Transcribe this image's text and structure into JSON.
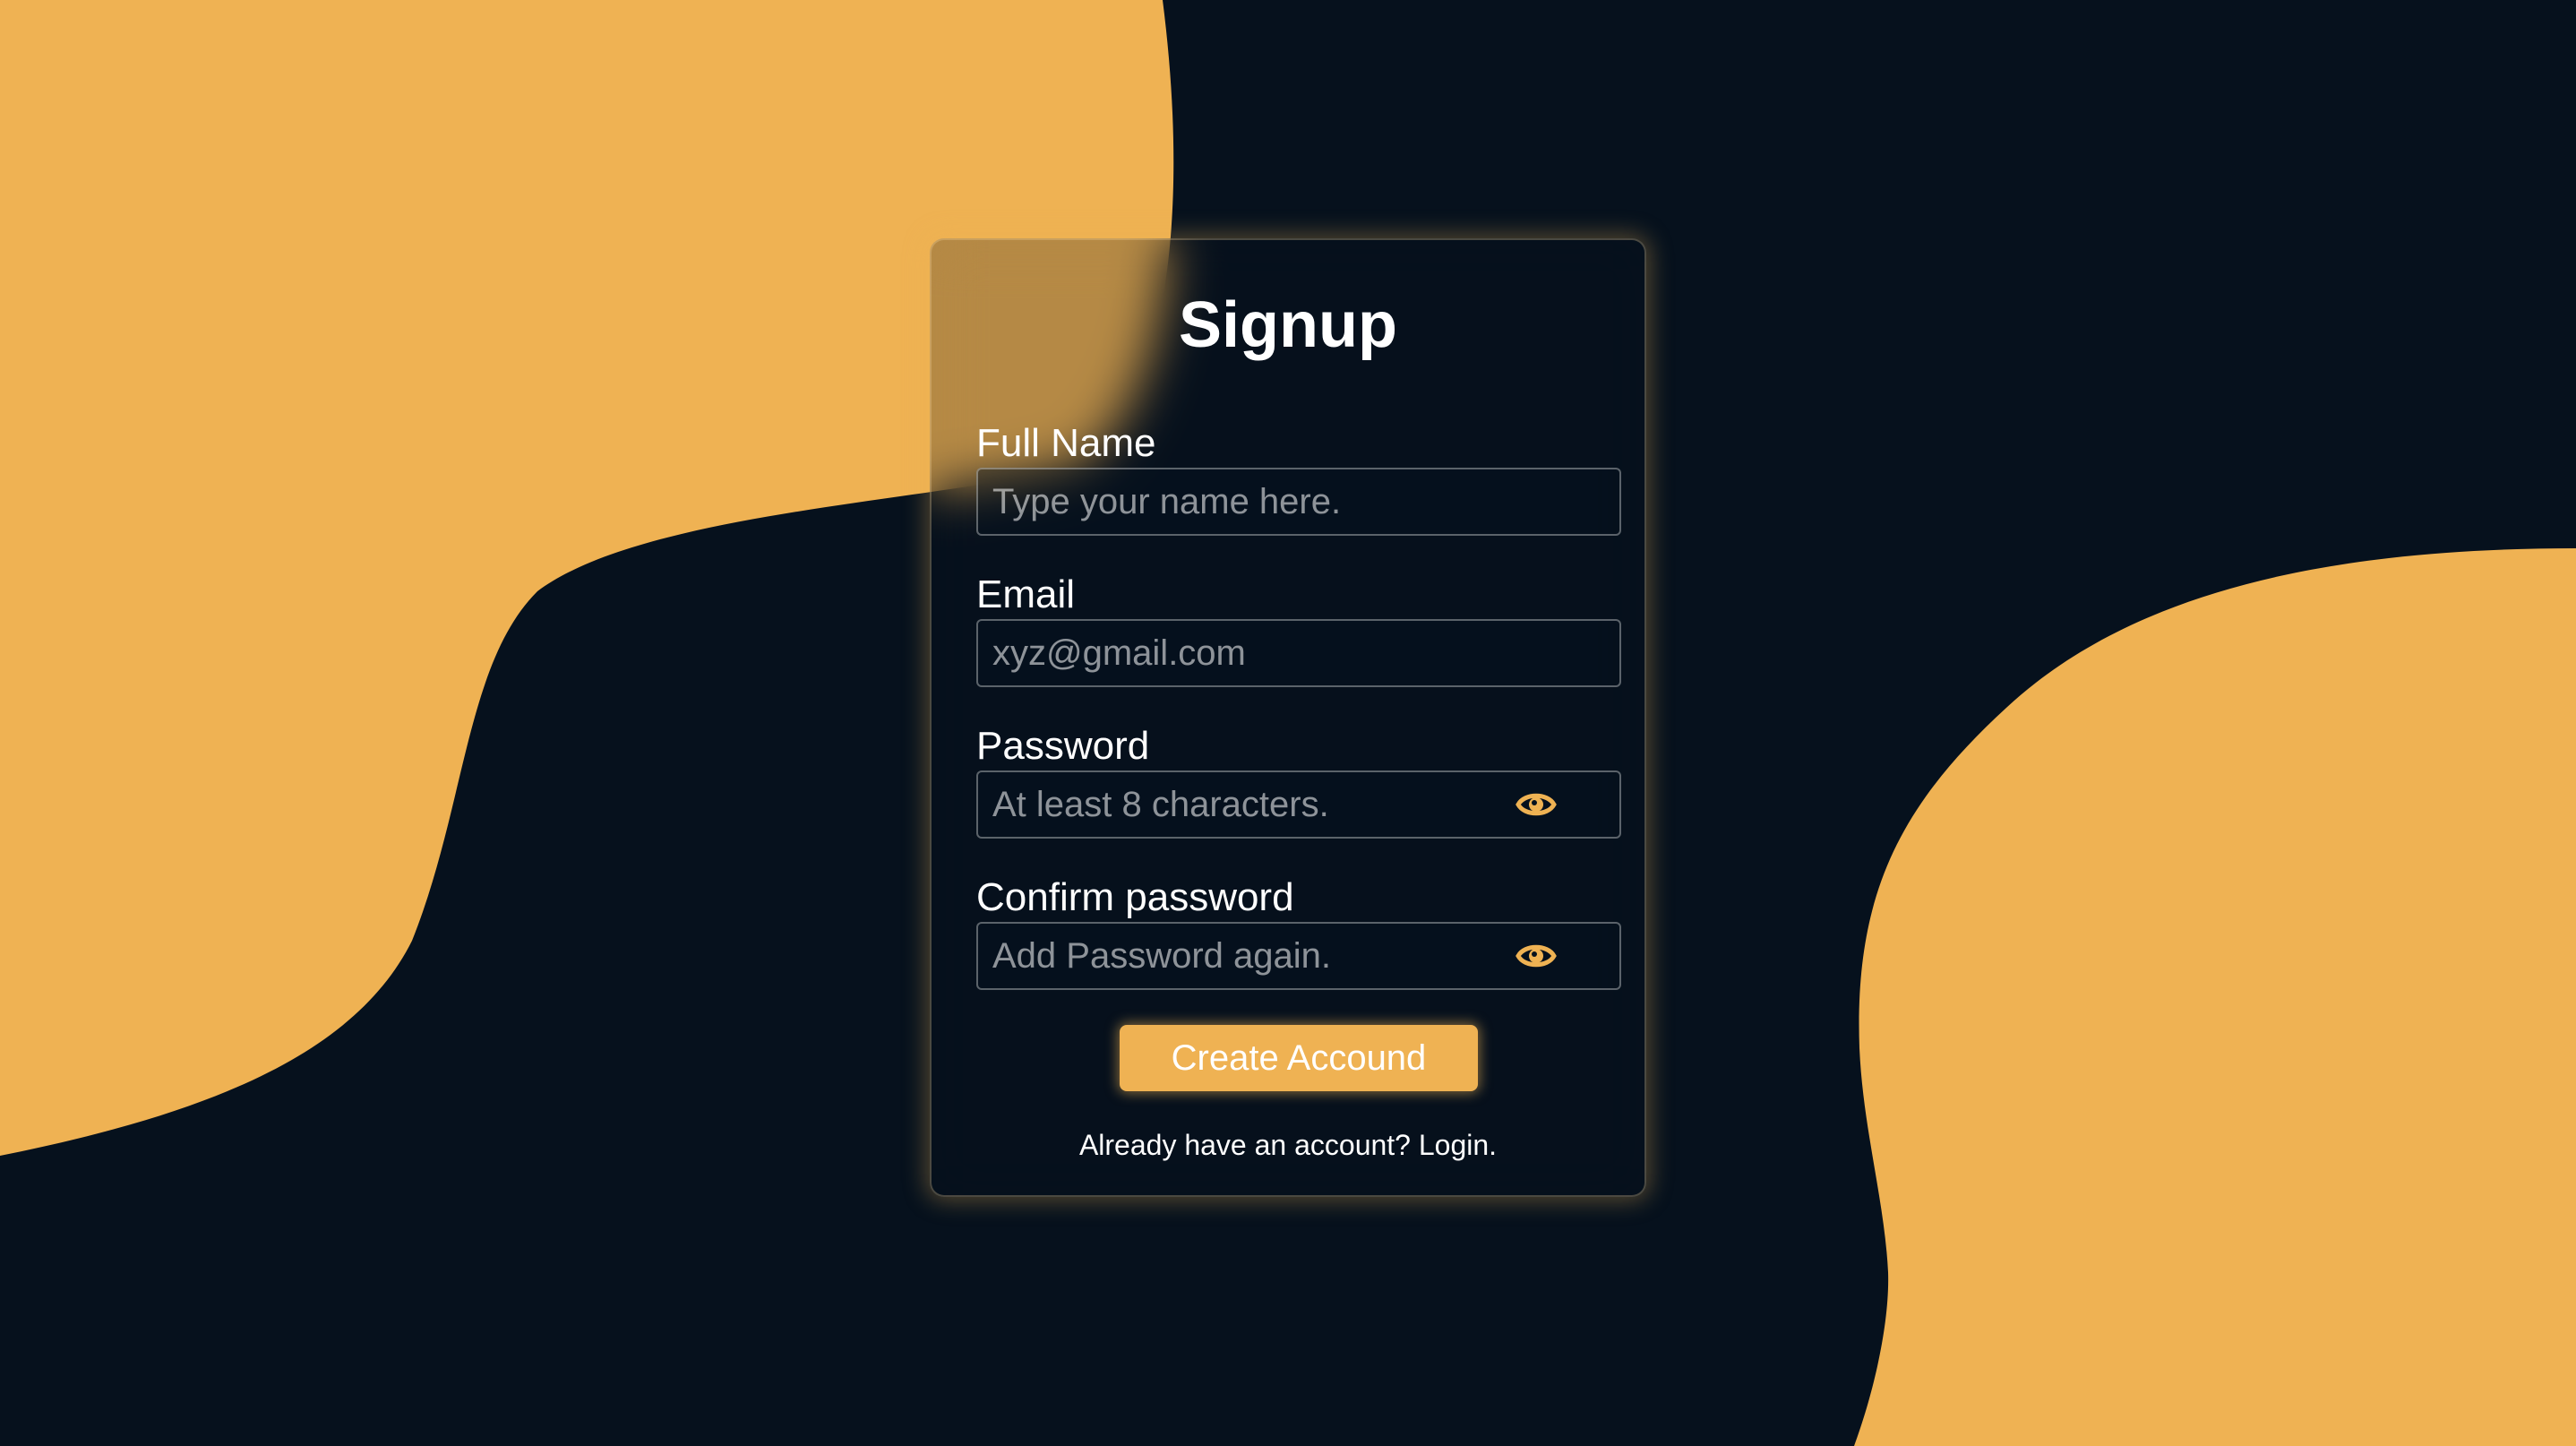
{
  "colors": {
    "background": "#06111d",
    "accent": "#efb253",
    "text": "#ffffff"
  },
  "form": {
    "title": "Signup",
    "fields": [
      {
        "label": "Full Name",
        "placeholder": "Type your name here.",
        "type": "text",
        "value": ""
      },
      {
        "label": "Email",
        "placeholder": "xyz@gmail.com",
        "type": "email",
        "value": ""
      },
      {
        "label": "Password",
        "placeholder": "At least 8 characters.",
        "type": "password",
        "value": "",
        "icon": "eye-icon"
      },
      {
        "label": "Confirm password",
        "placeholder": "Add Password again.",
        "type": "password",
        "value": "",
        "icon": "eye-icon"
      }
    ],
    "submit_label": "Create Accound",
    "login_prompt": "Already have an account?",
    "login_link": "Login."
  }
}
